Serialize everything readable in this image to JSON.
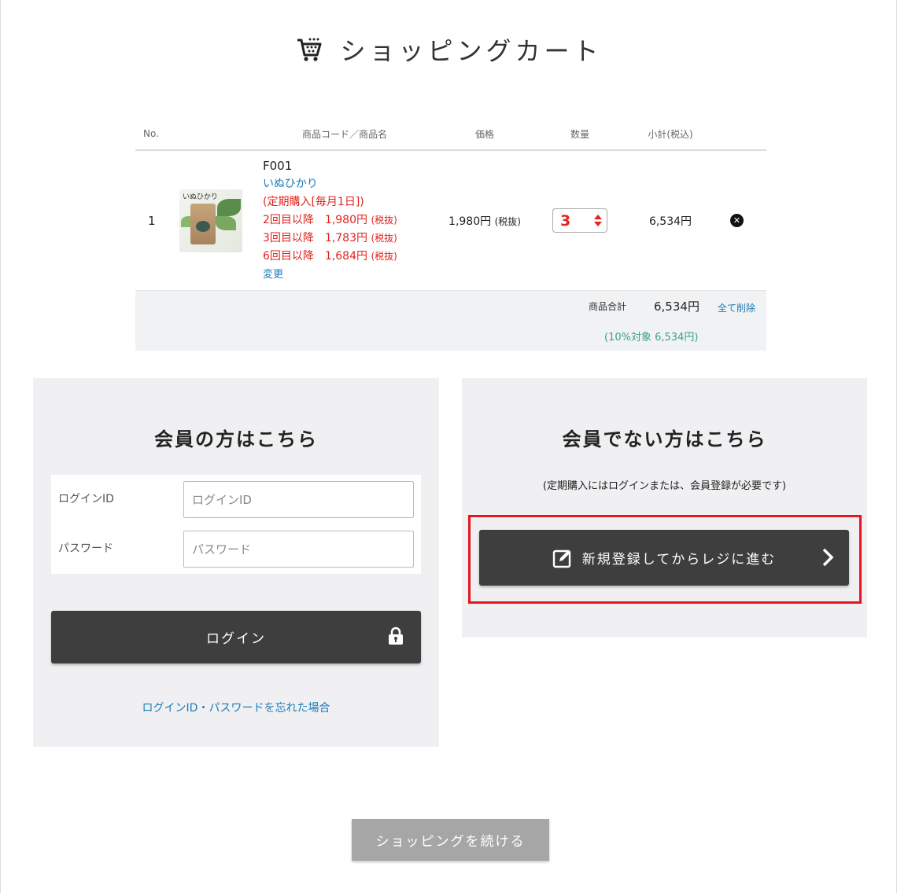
{
  "page": {
    "title": "ショッピングカート"
  },
  "cart": {
    "headers": {
      "no": "No.",
      "product": "商品コード／商品名",
      "price": "価格",
      "quantity": "数量",
      "subtotal": "小計(税込)"
    },
    "items": [
      {
        "no": "1",
        "image_label": "いぬひかり",
        "code": "F001",
        "name": "いぬひかり",
        "subscription": "(定期購入[毎月1日])",
        "tiers": [
          {
            "label": "2回目以降",
            "price": "1,980円",
            "tax": "(税抜)"
          },
          {
            "label": "3回目以降",
            "price": "1,783円",
            "tax": "(税抜)"
          },
          {
            "label": "6回目以降",
            "price": "1,684円",
            "tax": "(税抜)"
          }
        ],
        "change_label": "変更",
        "price": "1,980円",
        "price_tax": "(税抜)",
        "quantity": "3",
        "subtotal": "6,534円"
      }
    ],
    "total_label": "商品合計",
    "total_value": "6,534円",
    "delete_all_label": "全て削除",
    "tax_note": "(10%対象 6,534円)"
  },
  "member": {
    "title": "会員の方はこちら",
    "login_id_label": "ログインID",
    "login_id_placeholder": "ログインID",
    "password_label": "パスワード",
    "password_placeholder": "パスワード",
    "login_button": "ログイン",
    "forgot_link": "ログインID・パスワードを忘れた場合"
  },
  "guest": {
    "title": "会員でない方はこちら",
    "note": "(定期購入にはログインまたは、会員登録が必要です)",
    "register_button": "新規登録してからレジに進む"
  },
  "continue_button": "ショッピングを続ける",
  "colors": {
    "accent_red": "#e0231c",
    "link_blue": "#1a7bb8",
    "button_dark": "#3e3e3e",
    "highlight": "#e8141b"
  },
  "icons": [
    "cart-icon",
    "close-icon",
    "lock-icon",
    "edit-icon",
    "chevron-right-icon"
  ]
}
